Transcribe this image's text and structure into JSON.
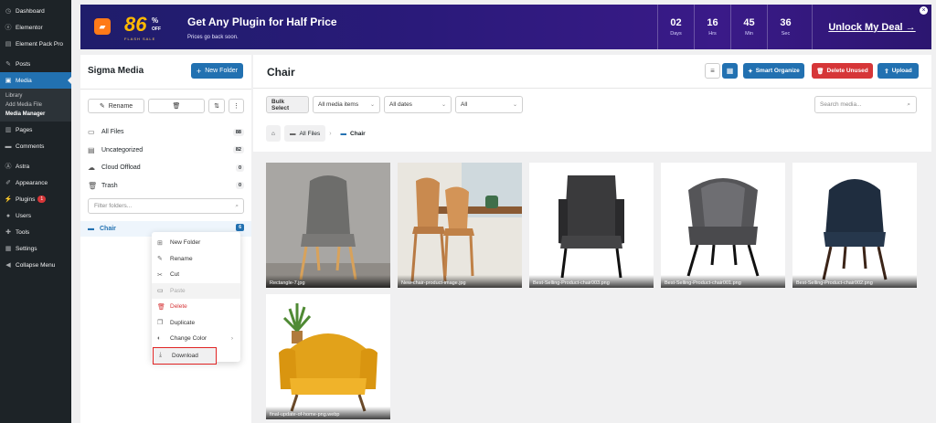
{
  "wp_sidebar": {
    "items": [
      {
        "label": "Dashboard",
        "icon": "dashboard-icon"
      },
      {
        "label": "Elementor",
        "icon": "elementor-icon"
      },
      {
        "label": "Element Pack Pro",
        "icon": "element-pack-icon"
      },
      {
        "label": "Posts",
        "icon": "pin-icon"
      },
      {
        "label": "Media",
        "icon": "media-icon"
      },
      {
        "label": "Pages",
        "icon": "pages-icon"
      },
      {
        "label": "Comments",
        "icon": "comments-icon"
      },
      {
        "label": "Astra",
        "icon": "astra-icon"
      },
      {
        "label": "Appearance",
        "icon": "brush-icon"
      },
      {
        "label": "Plugins",
        "icon": "plugin-icon",
        "badge": "1"
      },
      {
        "label": "Users",
        "icon": "users-icon"
      },
      {
        "label": "Tools",
        "icon": "wrench-icon"
      },
      {
        "label": "Settings",
        "icon": "settings-icon"
      },
      {
        "label": "Collapse Menu",
        "icon": "collapse-icon"
      }
    ],
    "media_submenu": [
      "Library",
      "Add Media File",
      "Media Manager"
    ]
  },
  "promo": {
    "big_number": "86",
    "percent": "%",
    "off": "OFF",
    "tag": "FLASH SALE",
    "title": "Get Any Plugin for Half Price",
    "subtitle": "Prices go back soon.",
    "countdown": [
      {
        "value": "02",
        "unit": "Days"
      },
      {
        "value": "16",
        "unit": "Hrs"
      },
      {
        "value": "45",
        "unit": "Min"
      },
      {
        "value": "36",
        "unit": "Sec"
      }
    ],
    "cta": "Unlock My Deal →",
    "close": "×"
  },
  "folder_panel": {
    "title": "Sigma Media",
    "new_folder": "New Folder",
    "rename": "Rename",
    "folders": [
      {
        "label": "All Files",
        "count": "88",
        "icon": "folder-icon"
      },
      {
        "label": "Uncategorized",
        "count": "82",
        "icon": "archive-icon"
      },
      {
        "label": "Cloud Offload",
        "count": "0",
        "icon": "cloud-icon"
      },
      {
        "label": "Trash",
        "count": "0",
        "icon": "trash-icon"
      }
    ],
    "filter_placeholder": "Filter folders...",
    "selected_folder": {
      "label": "Chair",
      "count": "6"
    }
  },
  "context_menu": {
    "items": [
      {
        "label": "New Folder",
        "icon": "new-folder-icon"
      },
      {
        "label": "Rename",
        "icon": "edit-icon"
      },
      {
        "label": "Cut",
        "icon": "scissors-icon"
      },
      {
        "label": "Paste",
        "icon": "paste-icon"
      },
      {
        "label": "Delete",
        "icon": "trash-icon"
      },
      {
        "label": "Duplicate",
        "icon": "duplicate-icon"
      },
      {
        "label": "Change Color",
        "icon": "palette-icon"
      },
      {
        "label": "Download",
        "icon": "download-icon"
      }
    ]
  },
  "main": {
    "title": "Chair",
    "smart_organize": "Smart Organize",
    "delete_unused": "Delete Unused",
    "upload": "Upload",
    "bulk_select": "Bulk Select",
    "filter_type": "All media items",
    "filter_date": "All dates",
    "filter_all": "All",
    "search_placeholder": "Search media...",
    "breadcrumb": {
      "root": "All Files",
      "current": "Chair"
    },
    "media": [
      {
        "name": "Rectangle-7.jpg"
      },
      {
        "name": "New-chair-product-image.jpg"
      },
      {
        "name": "Best-Selling-Product-chair003.png"
      },
      {
        "name": "Best-Selling-Product-chair001.png"
      },
      {
        "name": "Best-Selling-Product-chair002.png"
      },
      {
        "name": "final-update-of-home-png.webp"
      }
    ]
  },
  "colors": {
    "wp_dark": "#1d2327",
    "wp_blue": "#2271b1",
    "promo_bg": "#2a1a7a",
    "danger": "#d63638",
    "upload_blue": "#2271b1"
  }
}
